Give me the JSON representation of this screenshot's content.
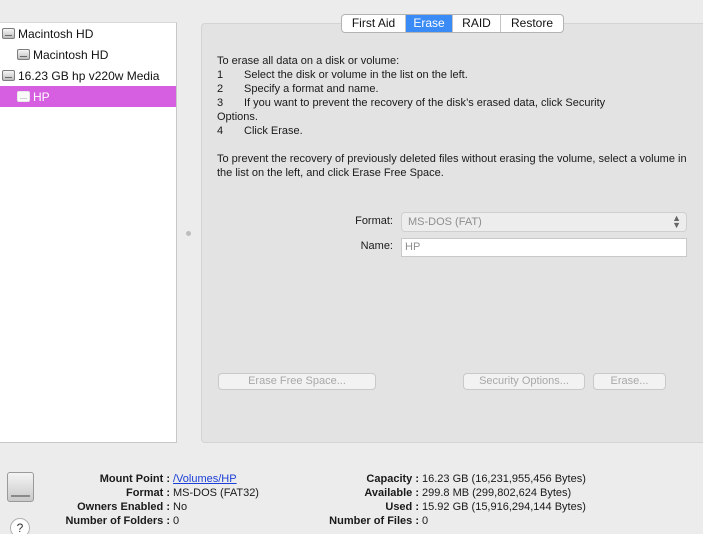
{
  "sidebar": {
    "items": [
      {
        "label": "Macintosh HD"
      },
      {
        "label": "Macintosh HD"
      },
      {
        "label": "16.23 GB hp v220w Media"
      },
      {
        "label": "HP"
      }
    ]
  },
  "tabs": [
    {
      "label": "First Aid"
    },
    {
      "label": "Erase"
    },
    {
      "label": "RAID"
    },
    {
      "label": "Restore"
    }
  ],
  "instructions": {
    "intro": "To erase all data on a disk or volume:",
    "steps": [
      {
        "num": "1",
        "text": "Select the disk or volume in the list on the left."
      },
      {
        "num": "2",
        "text": "Specify a format and name."
      },
      {
        "num": "3",
        "text": "If you want to prevent the recovery of the disk’s erased data, click Security"
      },
      {
        "num": "4",
        "text": "Click Erase."
      }
    ],
    "step3_continued": "Options.",
    "free_space": "To prevent the recovery of previously deleted files without erasing the volume, select a volume in the list on the left, and click Erase Free Space."
  },
  "form": {
    "format_label": "Format:",
    "format_value": "MS-DOS (FAT)",
    "name_label": "Name:",
    "name_value": "HP"
  },
  "buttons": {
    "erase_free_space": "Erase Free Space...",
    "security_options": "Security Options...",
    "erase": "Erase..."
  },
  "info": {
    "mount_point": {
      "key": "Mount Point :",
      "value": "/Volumes/HP"
    },
    "format": {
      "key": "Format :",
      "value": "MS-DOS (FAT32)"
    },
    "owners_enabled": {
      "key": "Owners Enabled :",
      "value": "No"
    },
    "number_of_folders": {
      "key": "Number of Folders :",
      "value": "0"
    },
    "capacity": {
      "key": "Capacity :",
      "value": "16.23 GB (16,231,955,456 Bytes)"
    },
    "available": {
      "key": "Available :",
      "value": "299.8 MB (299,802,624 Bytes)"
    },
    "used": {
      "key": "Used :",
      "value": "15.92 GB (15,916,294,144 Bytes)"
    },
    "number_of_files": {
      "key": "Number of Files :",
      "value": "0"
    }
  },
  "help": {
    "label": "?"
  },
  "colors": {
    "selection": "#d65ee0",
    "active_tab": "#3a8bf6",
    "link": "#1a3fd8"
  }
}
